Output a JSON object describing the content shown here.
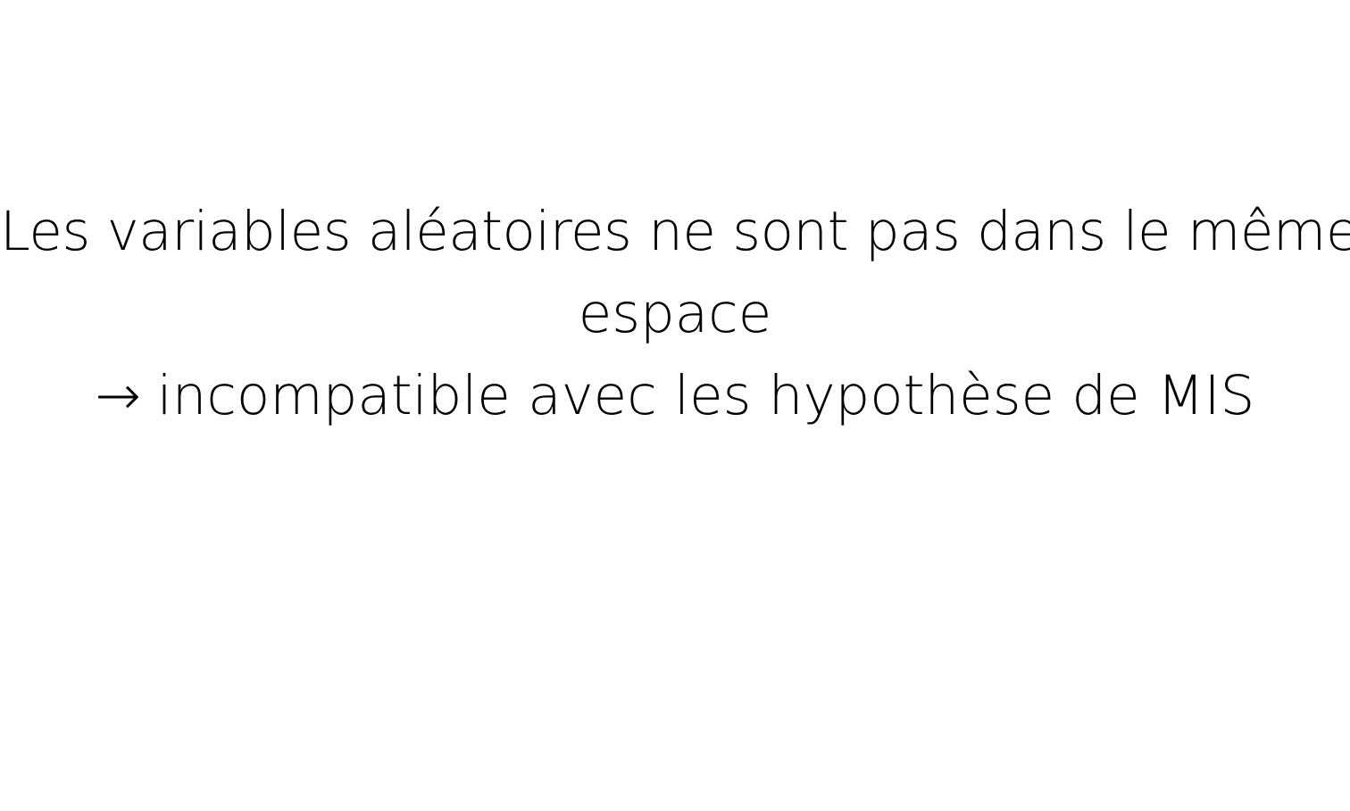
{
  "slide": {
    "line1": "Les variables aléatoires ne sont pas dans le même",
    "line2": "espace",
    "line3_arrow": "→",
    "line3_text": "incompatible avec les hypothèse de MIS"
  }
}
